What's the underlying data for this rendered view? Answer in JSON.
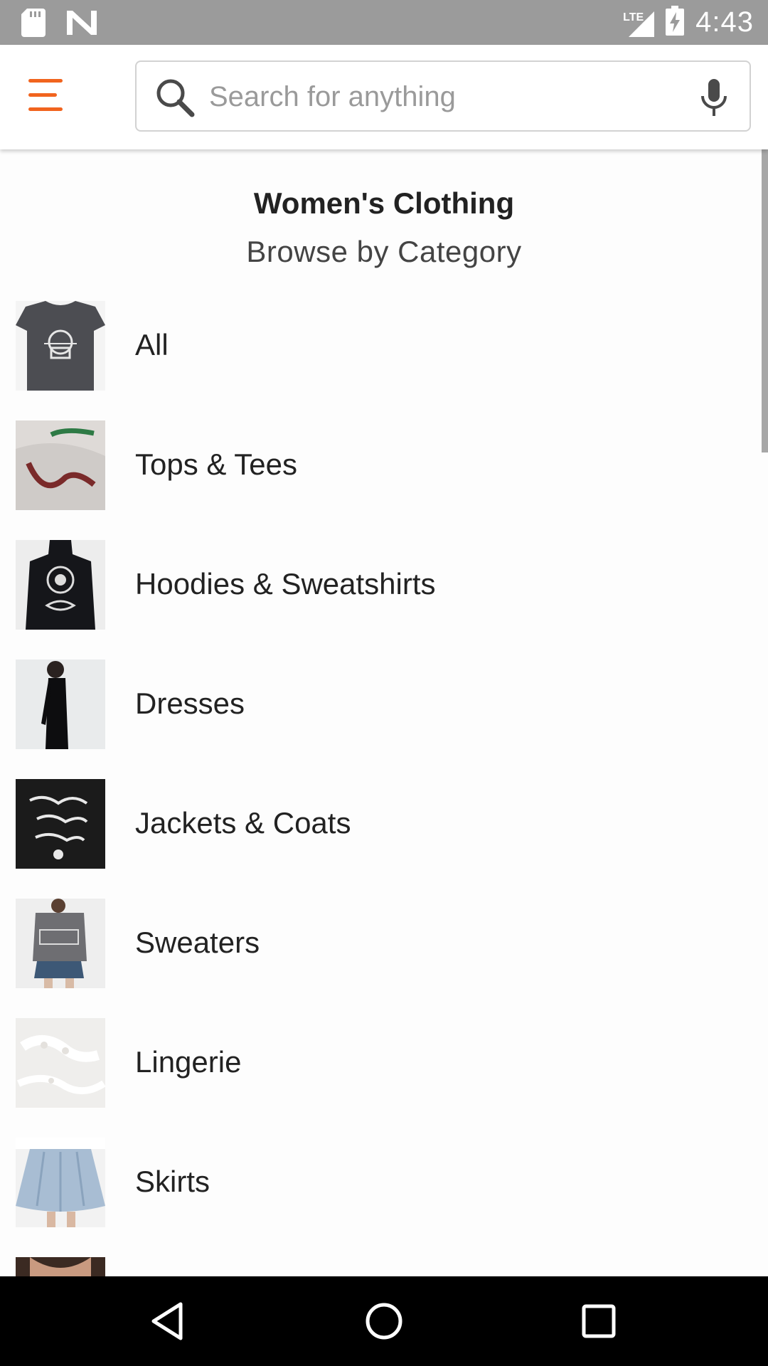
{
  "status_bar": {
    "time": "4:43",
    "network": "LTE",
    "left_icons": [
      "sd-card-icon",
      "n-notification-icon"
    ],
    "right_icons": [
      "lte-signal-icon",
      "battery-charging-icon"
    ]
  },
  "search": {
    "placeholder": "Search for anything"
  },
  "page": {
    "title": "Women's Clothing",
    "subtitle": "Browse by Category"
  },
  "categories": [
    {
      "label": "All"
    },
    {
      "label": "Tops & Tees"
    },
    {
      "label": "Hoodies & Sweatshirts"
    },
    {
      "label": "Dresses"
    },
    {
      "label": "Jackets & Coats"
    },
    {
      "label": "Sweaters"
    },
    {
      "label": "Lingerie"
    },
    {
      "label": "Skirts"
    },
    {
      "label": ""
    }
  ],
  "colors": {
    "accent": "#f1641e",
    "status_bar": "#9b9b9b",
    "nav_bar": "#000000"
  }
}
